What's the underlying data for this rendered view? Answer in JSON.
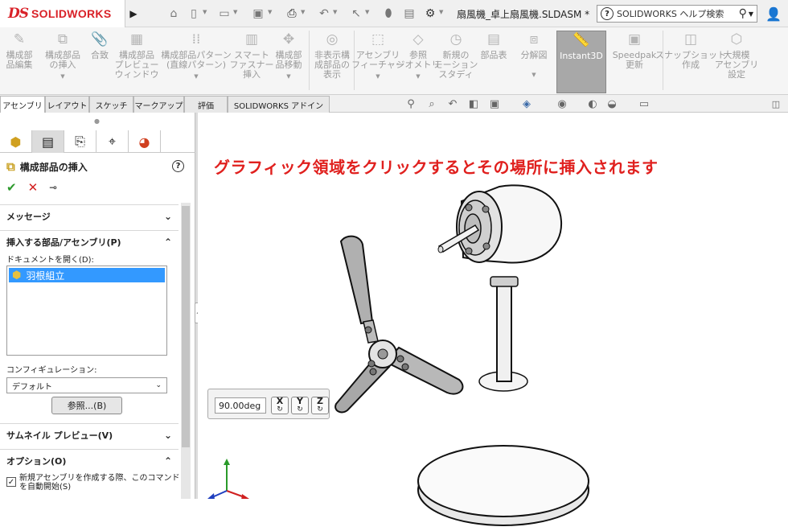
{
  "app": {
    "logo_mark": "DS",
    "logo_text": "SOLIDWORKS",
    "document_title": "扇風機_卓上扇風機.SLDASM *",
    "help_search_placeholder": "SOLIDWORKS ヘルプ検索"
  },
  "quick_access": [
    "home-icon",
    "new-document-icon",
    "open-icon",
    "save-icon",
    "print-icon",
    "undo-icon",
    "select-icon",
    "rebuild-icon",
    "file-properties-icon",
    "options-icon"
  ],
  "ribbon": {
    "buttons": [
      {
        "label": "構成部\n品編集",
        "icon": "edit-component-icon"
      },
      {
        "label": "構成部品\nの挿入",
        "icon": "insert-components-icon",
        "dropdown": true
      },
      {
        "label": "合致",
        "icon": "mate-icon"
      },
      {
        "label": "構成部品\nプレビュー\nウィンドウ",
        "icon": "component-preview-icon"
      },
      {
        "label": "構成部品パターン\n(直線パターン)",
        "icon": "linear-pattern-icon",
        "dropdown": true
      },
      {
        "label": "スマート\nファスナー\n挿入",
        "icon": "smart-fasteners-icon"
      },
      {
        "label": "構成部\n品移動",
        "icon": "move-component-icon",
        "dropdown": true
      },
      {
        "label": "非表示構\n成部品の\n表示",
        "icon": "show-hidden-icon"
      },
      {
        "label": "アセンブリ\nフィーチャー",
        "icon": "assembly-features-icon",
        "dropdown": true
      },
      {
        "label": "参照\nジオメトリ",
        "icon": "reference-geometry-icon",
        "dropdown": true
      },
      {
        "label": "新規の\nモーション\nスタディ",
        "icon": "motion-study-icon"
      },
      {
        "label": "部品表",
        "icon": "bom-icon"
      },
      {
        "label": "分解図",
        "icon": "exploded-view-icon",
        "dropdown": true
      },
      {
        "label": "Instant3D",
        "icon": "instant3d-icon"
      },
      {
        "label": "Speedpak\n更新",
        "icon": "speedpak-icon"
      },
      {
        "label": "スナップショット\n作成",
        "icon": "snapshot-icon"
      },
      {
        "label": "大規模\nアセンブリ\n設定",
        "icon": "large-assembly-icon"
      }
    ],
    "active": "Instant3D"
  },
  "tabs": [
    "アセンブリ",
    "レイアウト",
    "スケッチ",
    "マークアップ",
    "評価",
    "SOLIDWORKS アドイン"
  ],
  "panel": {
    "title": "構成部品の挿入",
    "sections": {
      "message": "メッセージ",
      "part_assembly": "挿入する部品/アセンブリ(P)",
      "thumbnail": "サムネイル プレビュー(V)",
      "options": "オプション(O)"
    },
    "open_docs_label": "ドキュメントを開く(D):",
    "open_docs": [
      "羽根組立"
    ],
    "config_label": "コンフィギュレーション:",
    "config_value": "デフォルト",
    "browse_label": "参照...(B)",
    "option_checkbox": "新規アセンブリを作成する際、このコマンドを自動開始(S)",
    "option_checked": true
  },
  "viewport": {
    "message": "グラフィック領域をクリックするとその場所に挿入されます",
    "rotation_value": "90.00deg",
    "rotate_axes": [
      "X",
      "Y",
      "Z"
    ]
  },
  "colors": {
    "brand": "#d92128",
    "message_red": "#e0201e",
    "selection_blue": "#3399ff",
    "ok_green": "#2d9a2d"
  }
}
